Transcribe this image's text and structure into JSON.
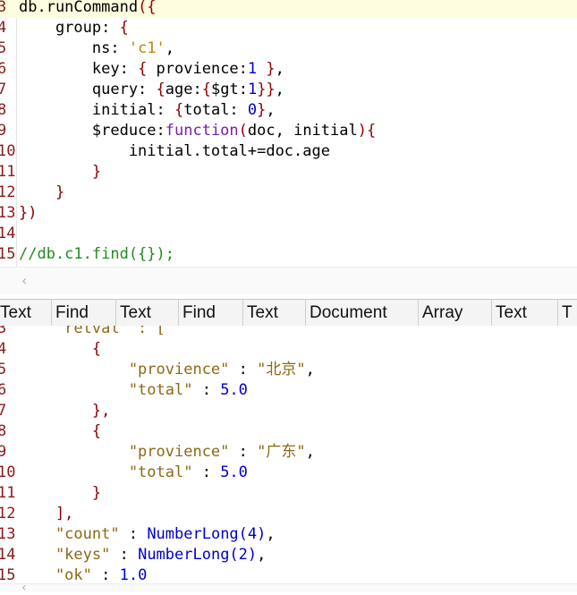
{
  "editor": {
    "lines": [
      {
        "num": "3",
        "parts": [
          [
            "kw",
            "db.runCommand"
          ],
          [
            "br",
            "({"
          ]
        ]
      },
      {
        "num": "4",
        "parts": [
          [
            "kw",
            "    group: "
          ],
          [
            "br",
            "{"
          ]
        ]
      },
      {
        "num": "5",
        "parts": [
          [
            "kw",
            "        ns: "
          ],
          [
            "str",
            "'c1'"
          ],
          [
            "kw",
            ","
          ]
        ]
      },
      {
        "num": "6",
        "parts": [
          [
            "kw",
            "        key: "
          ],
          [
            "br",
            "{"
          ],
          [
            "kw",
            " provience:"
          ],
          [
            "num",
            "1"
          ],
          [
            "kw",
            " "
          ],
          [
            "br",
            "}"
          ],
          [
            "kw",
            ","
          ]
        ]
      },
      {
        "num": "7",
        "parts": [
          [
            "kw",
            "        query: "
          ],
          [
            "br",
            "{"
          ],
          [
            "kw",
            "age:"
          ],
          [
            "br",
            "{"
          ],
          [
            "kw",
            "$gt:"
          ],
          [
            "num",
            "1"
          ],
          [
            "br",
            "}}"
          ],
          [
            "kw",
            ","
          ]
        ]
      },
      {
        "num": "8",
        "parts": [
          [
            "kw",
            "        initial: "
          ],
          [
            "br",
            "{"
          ],
          [
            "kw",
            "total: "
          ],
          [
            "num",
            "0"
          ],
          [
            "br",
            "}"
          ],
          [
            "kw",
            ","
          ]
        ]
      },
      {
        "num": "9",
        "parts": [
          [
            "kw",
            "        $reduce:"
          ],
          [
            "fn",
            "function"
          ],
          [
            "br",
            "("
          ],
          [
            "kw",
            "doc, initial"
          ],
          [
            "br",
            "){"
          ]
        ]
      },
      {
        "num": "10",
        "parts": [
          [
            "kw",
            "            initial.total+=doc.age"
          ]
        ]
      },
      {
        "num": "11",
        "parts": [
          [
            "br",
            "        }"
          ]
        ]
      },
      {
        "num": "12",
        "parts": [
          [
            "br",
            "    }"
          ]
        ]
      },
      {
        "num": "13",
        "parts": [
          [
            "br",
            "})"
          ]
        ]
      },
      {
        "num": "14",
        "parts": []
      },
      {
        "num": "15",
        "parts": [
          [
            "cm",
            "//db.c1.find({});"
          ]
        ]
      }
    ]
  },
  "tabs": [
    "Text",
    "Find",
    "Text",
    "Find",
    "Text",
    "Document",
    "Array",
    "Text",
    "T"
  ],
  "result": {
    "lines": [
      {
        "num": "3",
        "parts": [
          [
            "rkey",
            "    \"retval\" : ["
          ]
        ]
      },
      {
        "num": "4",
        "parts": [
          [
            "br",
            "        {"
          ]
        ]
      },
      {
        "num": "5",
        "parts": [
          [
            "rkey",
            "            \"provience\""
          ],
          [
            "kw",
            " : "
          ],
          [
            "rstr",
            "\"北京\""
          ],
          [
            "kw",
            ","
          ]
        ]
      },
      {
        "num": "6",
        "parts": [
          [
            "rkey",
            "            \"total\""
          ],
          [
            "kw",
            " : "
          ],
          [
            "num",
            "5.0"
          ]
        ]
      },
      {
        "num": "7",
        "parts": [
          [
            "br",
            "        },"
          ]
        ]
      },
      {
        "num": "8",
        "parts": [
          [
            "br",
            "        {"
          ]
        ]
      },
      {
        "num": "9",
        "parts": [
          [
            "rkey",
            "            \"provience\""
          ],
          [
            "kw",
            " : "
          ],
          [
            "rstr",
            "\"广东\""
          ],
          [
            "kw",
            ","
          ]
        ]
      },
      {
        "num": "10",
        "parts": [
          [
            "rkey",
            "            \"total\""
          ],
          [
            "kw",
            " : "
          ],
          [
            "num",
            "5.0"
          ]
        ]
      },
      {
        "num": "11",
        "parts": [
          [
            "br",
            "        }"
          ]
        ]
      },
      {
        "num": "12",
        "parts": [
          [
            "br",
            "    ],"
          ]
        ]
      },
      {
        "num": "13",
        "parts": [
          [
            "rkey",
            "    \"count\""
          ],
          [
            "kw",
            " : "
          ],
          [
            "num",
            "NumberLong(4)"
          ],
          [
            "kw",
            ","
          ]
        ]
      },
      {
        "num": "14",
        "parts": [
          [
            "rkey",
            "    \"keys\""
          ],
          [
            "kw",
            " : "
          ],
          [
            "num",
            "NumberLong(2)"
          ],
          [
            "kw",
            ","
          ]
        ]
      },
      {
        "num": "15",
        "parts": [
          [
            "rkey",
            "    \"ok\""
          ],
          [
            "kw",
            " : "
          ],
          [
            "num",
            "1.0"
          ]
        ]
      }
    ]
  },
  "scroll": {
    "left_arrow": "‹"
  }
}
